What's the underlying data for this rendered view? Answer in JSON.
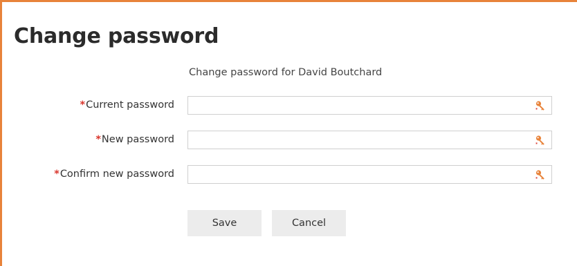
{
  "page": {
    "title": "Change password",
    "subtitle": "Change password for David Boutchard"
  },
  "form": {
    "required_marker": "*",
    "fields": [
      {
        "label": "Current password",
        "value": "",
        "icon": "key-icon"
      },
      {
        "label": "New password",
        "value": "",
        "icon": "key-icon"
      },
      {
        "label": "Confirm new password",
        "value": "",
        "icon": "key-icon"
      }
    ]
  },
  "buttons": {
    "save": "Save",
    "cancel": "Cancel"
  },
  "colors": {
    "accent_border": "#e8833a",
    "required": "#d9342b",
    "key_icon": "#e8833a"
  }
}
